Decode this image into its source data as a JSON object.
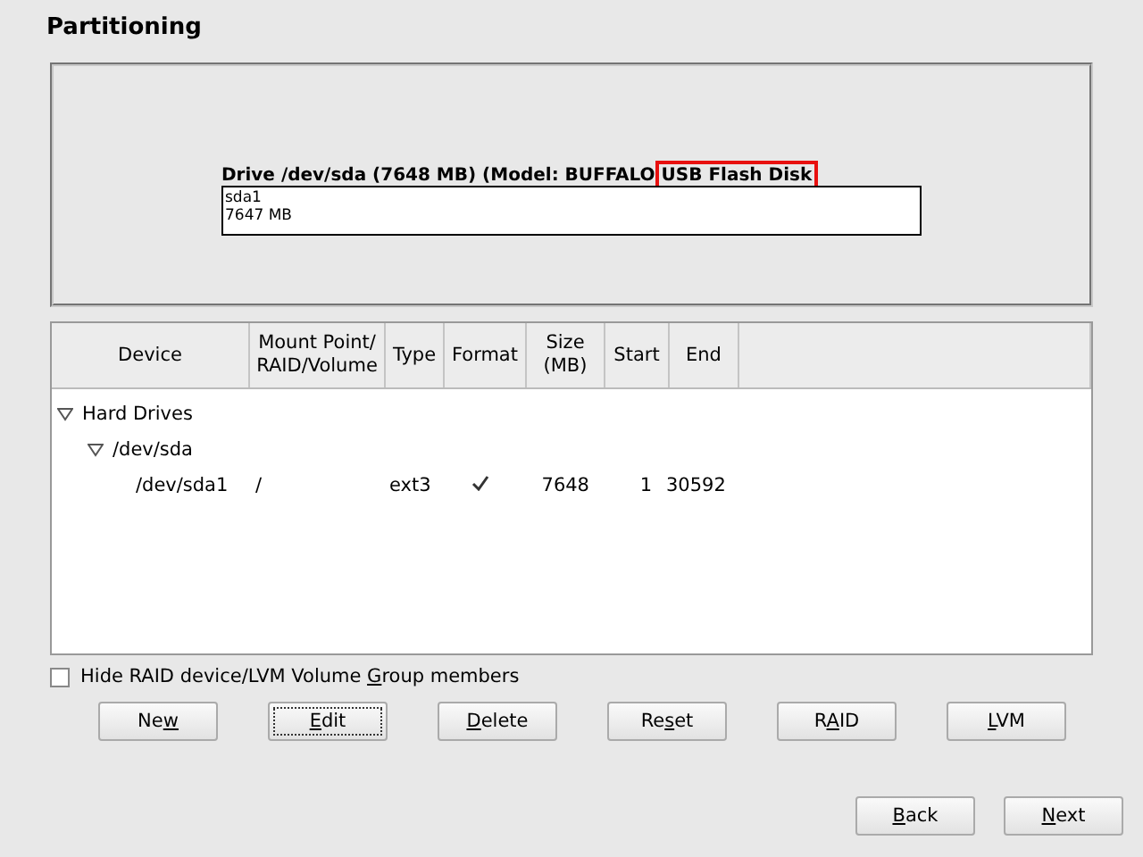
{
  "title": "Partitioning",
  "drive": {
    "label": "Drive /dev/sda (7648 MB) (Model: BUFFALO",
    "highlighted": "USB Flash Disk",
    "partitions": [
      {
        "name": "sda1",
        "size": "7647 MB"
      }
    ]
  },
  "table": {
    "columns": [
      "Device",
      "Mount Point/\nRAID/Volume",
      "Type",
      "Format",
      "Size\n(MB)",
      "Start",
      "End"
    ],
    "rows": [
      {
        "device": "Hard Drives",
        "expanded": true,
        "children": [
          {
            "device": "/dev/sda",
            "expanded": true,
            "children": [
              {
                "device": "/dev/sda1",
                "mount": "/",
                "type": "ext3",
                "format": true,
                "size": "7648",
                "start": "1",
                "end": "30592"
              }
            ]
          }
        ]
      }
    ]
  },
  "hide_members": {
    "pre": "Hide RAID device/LVM Volume ",
    "key": "G",
    "post": "roup members",
    "checked": false
  },
  "actions": [
    {
      "pre": "Ne",
      "key": "w",
      "focused": false
    },
    {
      "key": "E",
      "post": "dit",
      "focused": true
    },
    {
      "key": "D",
      "post": "elete",
      "focused": false
    },
    {
      "pre": "Re",
      "key": "s",
      "post": "et",
      "focused": false
    },
    {
      "pre": "R",
      "key": "A",
      "post": "ID",
      "focused": false
    },
    {
      "key": "L",
      "post": "VM",
      "focused": false
    }
  ],
  "nav": [
    {
      "key": "B",
      "post": "ack",
      "focused": false
    },
    {
      "key": "N",
      "post": "ext",
      "focused": false
    }
  ]
}
